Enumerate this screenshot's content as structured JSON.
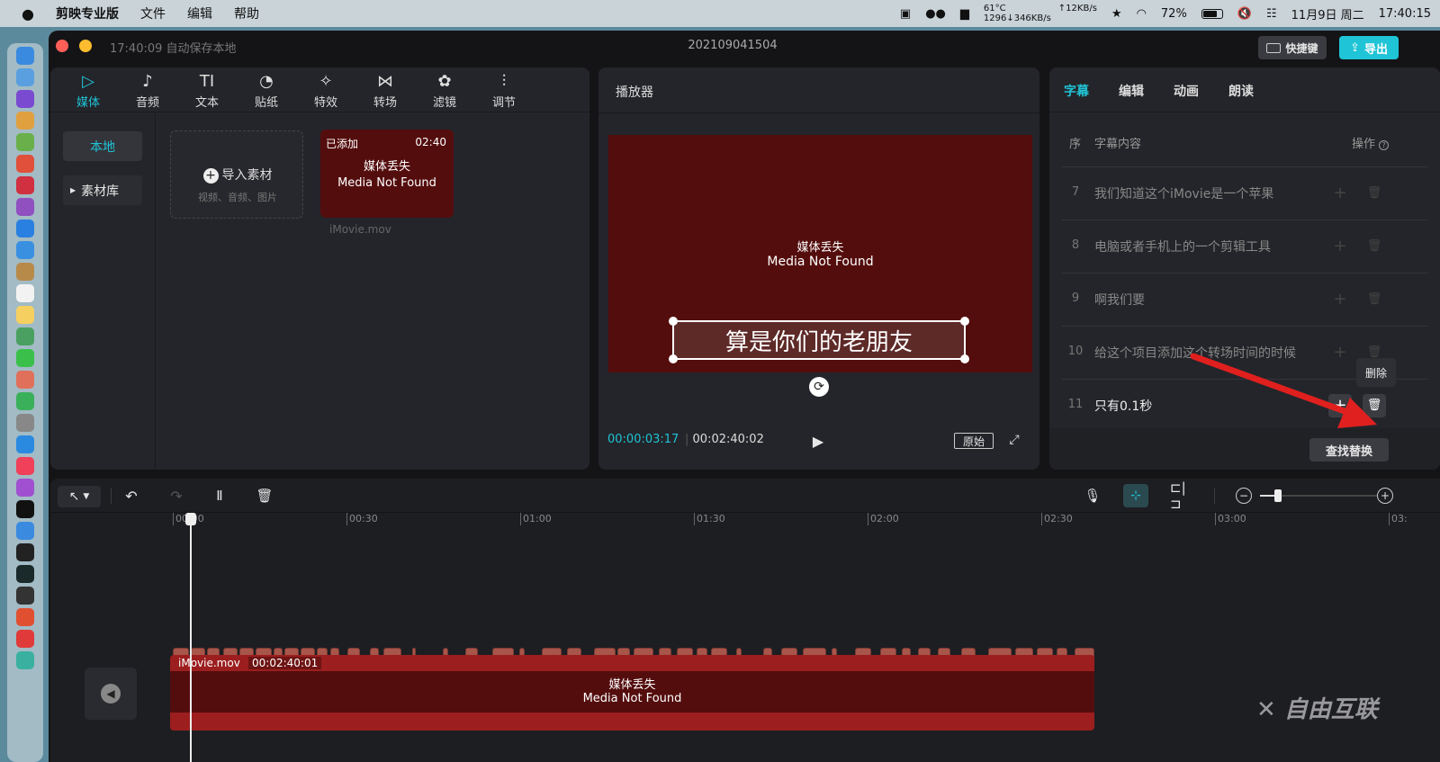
{
  "menubar": {
    "app": "剪映专业版",
    "menus": [
      "文件",
      "编辑",
      "帮助"
    ],
    "temp": "61°C",
    "net_up": "↑12KB/s",
    "net_line2": "1296↓346KB/s",
    "battery": "72%",
    "date": "11月9日 周二",
    "time": "17:40:15"
  },
  "titlebar": {
    "autosave": "17:40:09 自动保存本地",
    "project": "202109041504",
    "shortcuts": "快捷键",
    "export": "导出"
  },
  "media": {
    "tabs": [
      "媒体",
      "音频",
      "文本",
      "贴纸",
      "特效",
      "转场",
      "滤镜",
      "调节"
    ],
    "side": [
      "本地",
      "素材库"
    ],
    "import_label": "导入素材",
    "import_hint": "视频、音频、图片",
    "clip": {
      "added": "已添加",
      "duration": "02:40",
      "missing_cn": "媒体丢失",
      "missing_en": "Media Not Found",
      "filename": "iMovie.mov"
    }
  },
  "player": {
    "title": "播放器",
    "missing_cn": "媒体丢失",
    "missing_en": "Media Not Found",
    "subtitle": "算是你们的老朋友",
    "current": "00:00:03:17",
    "total": "00:02:40:02",
    "ratio": "原始"
  },
  "subs": {
    "tabs": [
      "字幕",
      "编辑",
      "动画",
      "朗读"
    ],
    "col_index": "序",
    "col_content": "字幕内容",
    "col_ops": "操作",
    "rows": [
      {
        "n": "7",
        "t": "我们知道这个iMovie是一个苹果"
      },
      {
        "n": "8",
        "t": "电脑或者手机上的一个剪辑工具"
      },
      {
        "n": "9",
        "t": "啊我们要"
      },
      {
        "n": "10",
        "t": "给这个项目添加这个转场时间的时候"
      },
      {
        "n": "11",
        "t": "只有0.1秒"
      }
    ],
    "tooltip": "删除",
    "find_replace": "查找替换"
  },
  "timeline": {
    "ruler": [
      "00:00",
      "00:30",
      "01:00",
      "01:30",
      "02:00",
      "02:30",
      "03:00",
      "03:"
    ],
    "clip_name": "iMovie.mov",
    "clip_dur": "00:02:40:01",
    "missing_cn": "媒体丢失",
    "missing_en": "Media Not Found"
  },
  "watermark": "自由互联",
  "colors": {
    "accent": "#1fc4d6",
    "clip_red": "#9c1e1e",
    "video_bg": "#540d0d",
    "arrow": "#e0201e"
  }
}
